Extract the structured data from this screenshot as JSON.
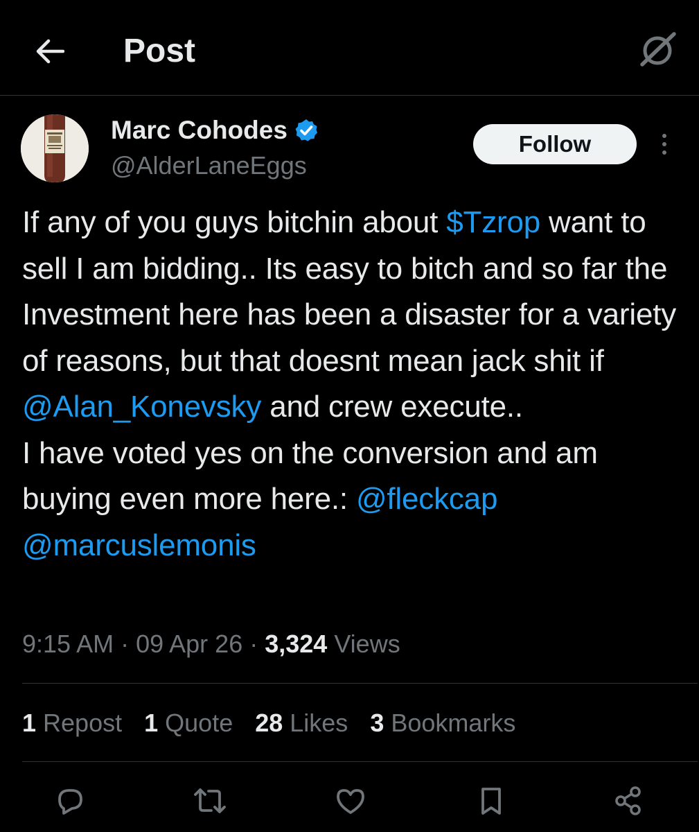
{
  "header": {
    "title": "Post",
    "back_icon": "arrow-left-icon",
    "grok_icon": "grok-icon"
  },
  "author": {
    "name": "Marc Cohodes",
    "handle": "@AlderLaneEggs",
    "verified": true,
    "verified_color": "#1d9bf0",
    "follow_label": "Follow"
  },
  "post": {
    "segments": [
      {
        "text": "If any of you guys bitchin about ",
        "link": false
      },
      {
        "text": "$Tzrop",
        "link": true
      },
      {
        "text": " want to sell I am bidding.. Its easy to bitch and so far the Investment here has been a disaster for a variety of reasons, but that doesnt mean jack shit if ",
        "link": false
      },
      {
        "text": "@Alan_Konevsky",
        "link": true
      },
      {
        "text": " and crew execute..\nI have voted yes on the conversion and am buying even more here.: ",
        "link": false
      },
      {
        "text": "@fleckcap",
        "link": true
      },
      {
        "text": "\n",
        "link": false
      },
      {
        "text": "@marcuslemonis",
        "link": true
      }
    ],
    "link_color": "#1d9bf0"
  },
  "meta": {
    "time": "9:15 AM",
    "sep1": " · ",
    "date": "09 Apr 26",
    "sep2": " · ",
    "views_count": "3,324",
    "views_label": " Views"
  },
  "stats": [
    {
      "count": "1",
      "label": " Repost"
    },
    {
      "count": "1",
      "label": " Quote"
    },
    {
      "count": "28",
      "label": " Likes"
    },
    {
      "count": "3",
      "label": " Bookmarks"
    }
  ],
  "actions": [
    "reply-icon",
    "repost-icon",
    "like-icon",
    "bookmark-icon",
    "share-icon"
  ]
}
